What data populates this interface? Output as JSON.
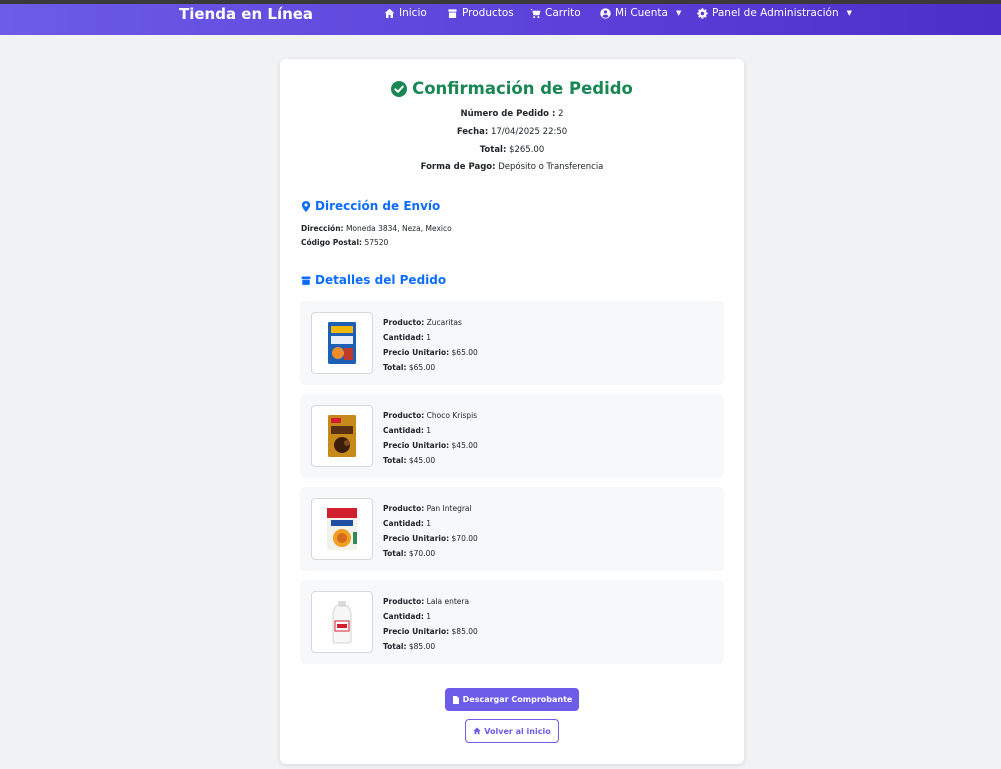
{
  "nav": {
    "brand": "Tienda en Línea",
    "items": [
      {
        "label": "Inicio",
        "icon": "home-icon"
      },
      {
        "label": "Productos",
        "icon": "box-icon"
      },
      {
        "label": "Carrito",
        "icon": "cart-icon"
      },
      {
        "label": "Mi Cuenta",
        "icon": "user-circle-icon"
      },
      {
        "label": "Panel de Administración",
        "icon": "gear-icon"
      }
    ]
  },
  "confirmation": {
    "title": "Confirmación de Pedido",
    "order_number_label": "Número de Pedido :",
    "order_number": "2",
    "date_label": "Fecha:",
    "date": "17/04/2025 22:50",
    "total_label": "Total:",
    "total": "$265.00",
    "payment_label": "Forma de Pago:",
    "payment": "Depósito o Transferencia"
  },
  "shipping": {
    "heading": "Dirección de Envío",
    "address_label": "Dirección:",
    "address": "Moneda 3834, Neza, Mexico",
    "zip_label": "Código Postal:",
    "zip": "57520"
  },
  "details": {
    "heading": "Detalles del Pedido",
    "labels": {
      "product": "Producto:",
      "quantity": "Cantidad:",
      "unit_price": "Precio Unitario:",
      "total": "Total:"
    },
    "items": [
      {
        "product": "Zucaritas",
        "quantity": "1",
        "unit_price": "$65.00",
        "total": "$65.00"
      },
      {
        "product": "Choco Krispis",
        "quantity": "1",
        "unit_price": "$45.00",
        "total": "$45.00"
      },
      {
        "product": "Pan Integral",
        "quantity": "1",
        "unit_price": "$70.00",
        "total": "$70.00"
      },
      {
        "product": "Lala entera",
        "quantity": "1",
        "unit_price": "$85.00",
        "total": "$85.00"
      }
    ]
  },
  "actions": {
    "download": "Descargar Comprobante",
    "home": "Volver al inicio"
  },
  "colors": {
    "accent": "#6c5ce7",
    "success": "#198754",
    "link": "#0d6efd"
  }
}
